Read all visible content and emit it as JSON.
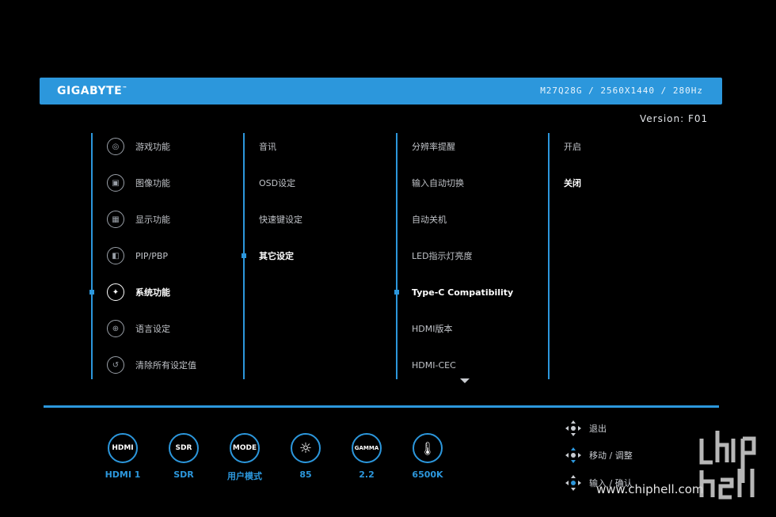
{
  "header": {
    "brand": "GIGABYTE",
    "brand_mark": "™",
    "model_info": "M27Q28G / 2560X1440 / 280Hz",
    "version": "Version: F01"
  },
  "menu": {
    "main": [
      {
        "label": "游戏功能",
        "icon": "gamepad-icon"
      },
      {
        "label": "图像功能",
        "icon": "picture-icon"
      },
      {
        "label": "显示功能",
        "icon": "display-grid-icon"
      },
      {
        "label": "PIP/PBP",
        "icon": "pip-icon"
      },
      {
        "label": "系统功能",
        "icon": "gear-icon",
        "selected": true
      },
      {
        "label": "语言设定",
        "icon": "globe-icon"
      },
      {
        "label": "清除所有设定值",
        "icon": "reset-icon"
      }
    ],
    "sub": [
      {
        "label": "音讯"
      },
      {
        "label": "OSD设定"
      },
      {
        "label": "快速键设定"
      },
      {
        "label": "其它设定",
        "selected": true
      }
    ],
    "options": [
      {
        "label": "分辨率提醒"
      },
      {
        "label": "输入自动切换"
      },
      {
        "label": "自动关机"
      },
      {
        "label": "LED指示灯亮度"
      },
      {
        "label": "Type-C Compatibility",
        "selected": true
      },
      {
        "label": "HDMI版本"
      },
      {
        "label": "HDMI-CEC"
      }
    ],
    "values": [
      {
        "label": "开启"
      },
      {
        "label": "关闭",
        "selected": true
      }
    ]
  },
  "status": [
    {
      "icon_text": "HDMI",
      "label": "HDMI 1"
    },
    {
      "icon_text": "SDR",
      "label": "SDR"
    },
    {
      "icon_text": "MODE",
      "label": "用户模式"
    },
    {
      "icon_text": "☼",
      "label": "85"
    },
    {
      "icon_text": "GAMMA",
      "label": "2.2"
    },
    {
      "icon_text": "🌡",
      "label": "6500K"
    }
  ],
  "hints": [
    {
      "label": "退出"
    },
    {
      "label": "移动 / 调整"
    },
    {
      "label": "输入 / 确认"
    }
  ],
  "watermark": {
    "url": "www.chiphell.com"
  },
  "colors": {
    "accent": "#2c97dc",
    "background": "#000000"
  }
}
